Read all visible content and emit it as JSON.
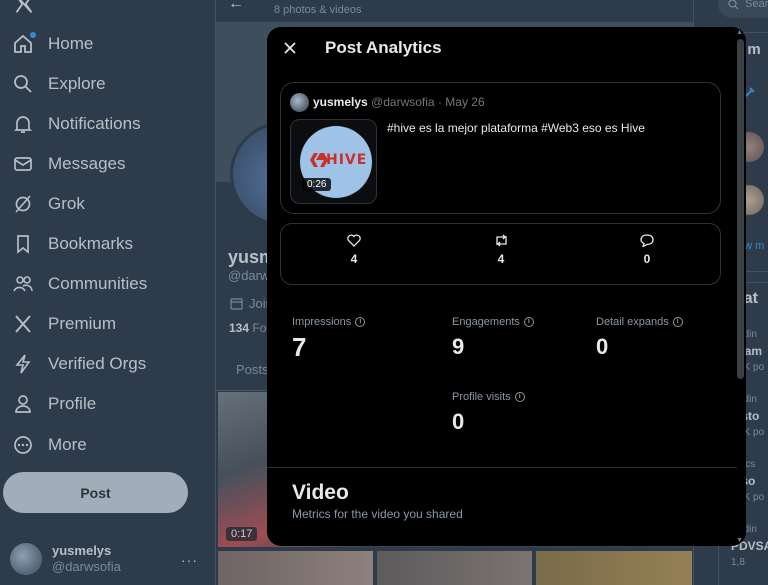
{
  "sidebar": {
    "logo": "x-logo-icon",
    "items": [
      {
        "label": "Home",
        "icon": "home-icon"
      },
      {
        "label": "Explore",
        "icon": "search-icon"
      },
      {
        "label": "Notifications",
        "icon": "bell-icon"
      },
      {
        "label": "Messages",
        "icon": "envelope-icon"
      },
      {
        "label": "Grok",
        "icon": "grok-icon"
      },
      {
        "label": "Bookmarks",
        "icon": "bookmark-icon"
      },
      {
        "label": "Communities",
        "icon": "people-icon"
      },
      {
        "label": "Premium",
        "icon": "x-icon"
      },
      {
        "label": "Verified Orgs",
        "icon": "lightning-icon"
      },
      {
        "label": "Profile",
        "icon": "person-icon"
      },
      {
        "label": "More",
        "icon": "more-circle-icon"
      }
    ],
    "post_label": "Post",
    "account": {
      "name": "yusmelys",
      "handle": "@darwsofia",
      "more": "···"
    }
  },
  "profile": {
    "photos_count": "8 photos & videos",
    "name": "yusm",
    "handle": "@darw",
    "joined": "Join",
    "follow_count": "134",
    "follow_label": "Fol",
    "tab": "Posts",
    "media": [
      {
        "duration": "0:17"
      }
    ]
  },
  "right": {
    "search_placeholder": "Sear",
    "panel_title": "u m",
    "show_more": "ow m",
    "whats_title": "hat",
    "trends": [
      {
        "meta": "ndin",
        "name": "cam",
        "count": "9K po"
      },
      {
        "meta": "ndin",
        "name": "isto",
        "count": "5K po"
      },
      {
        "meta": "itics",
        "name": "lso",
        "count": "8K po"
      },
      {
        "meta": "ndin",
        "name": "PDVSA",
        "count": "1,8"
      }
    ]
  },
  "modal": {
    "title": "Post Analytics",
    "close_icon": "close-icon",
    "post": {
      "author": "yusmelys",
      "handle": "@darwsofia",
      "date": "May 26",
      "text": "#hive es la mejor plataforma #Web3 eso es Hive",
      "thumb_word": "HIVE",
      "duration": "0:26"
    },
    "stats": [
      {
        "icon": "heart-icon",
        "value": "4"
      },
      {
        "icon": "repost-icon",
        "value": "4"
      },
      {
        "icon": "reply-icon",
        "value": "0"
      }
    ],
    "metrics": [
      {
        "label": "Impressions",
        "value": "7"
      },
      {
        "label": "Engagements",
        "value": "9"
      },
      {
        "label": "Detail expands",
        "value": "0"
      },
      {
        "label": "Profile visits",
        "value": "0"
      }
    ],
    "video": {
      "title": "Video",
      "subtitle": "Metrics for the video you shared"
    }
  },
  "colors": {
    "background": "#15202b",
    "modal": "#000000",
    "accent": "#1d9bf0",
    "hive_red": "#c9302c"
  }
}
